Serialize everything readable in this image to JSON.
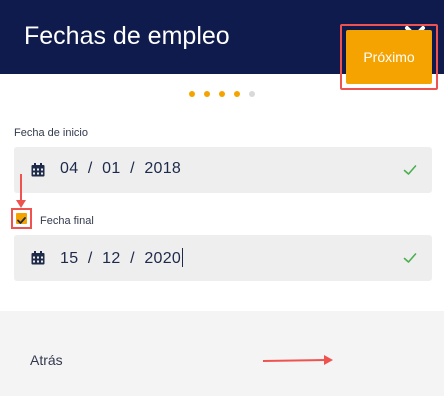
{
  "header": {
    "title": "Fechas de empleo",
    "close_icon": "close-icon"
  },
  "steps": {
    "total": 5,
    "active": 4
  },
  "start_date": {
    "label": "Fecha de inicio",
    "day": "04",
    "month": "01",
    "year": "2018",
    "separator": "/"
  },
  "end_date": {
    "checkbox_checked": true,
    "label": "Fecha final",
    "day": "15",
    "month": "12",
    "year": "2020",
    "separator": "/"
  },
  "footer": {
    "back_label": "Atrás",
    "next_label": "Próximo"
  },
  "colors": {
    "header_bg": "#0f1b4d",
    "accent": "#f5a300",
    "annotation": "#ef5350",
    "valid": "#4caf50",
    "field_bg": "#eeeeee"
  }
}
